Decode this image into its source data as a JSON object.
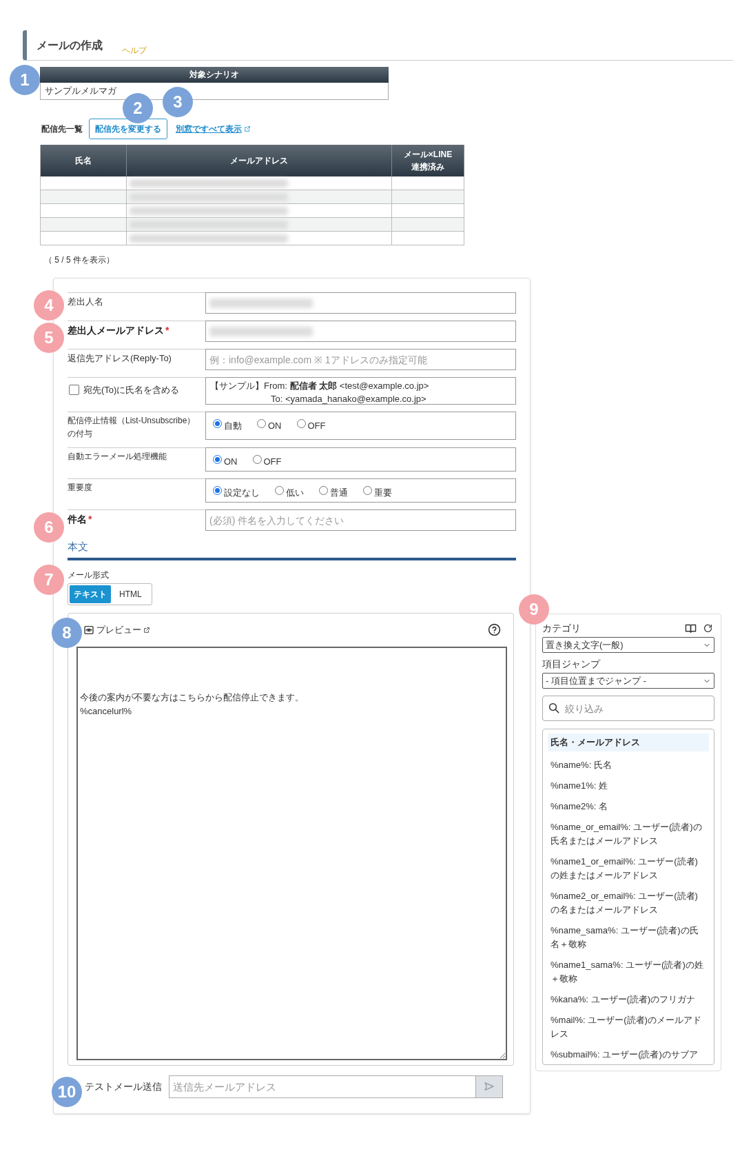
{
  "header": {
    "title": "メールの作成",
    "help_link": "ヘルプ"
  },
  "annotations": [
    {
      "label": "1",
      "color": "#7ba3d9"
    },
    {
      "label": "2",
      "color": "#7ba3d9"
    },
    {
      "label": "3",
      "color": "#7ba3d9"
    },
    {
      "label": "4",
      "color": "#f4a3a8"
    },
    {
      "label": "5",
      "color": "#f4a3a8"
    },
    {
      "label": "6",
      "color": "#f4a3a8"
    },
    {
      "label": "7",
      "color": "#f4a3a8"
    },
    {
      "label": "8",
      "color": "#7ba3d9"
    },
    {
      "label": "9",
      "color": "#f4a3a8"
    },
    {
      "label": "10",
      "color": "#7ba3d9"
    }
  ],
  "scenario": {
    "heading": "対象シナリオ",
    "value": "サンプルメルマガ"
  },
  "recipients": {
    "label": "配信先一覧",
    "change_button": "配信先を変更する",
    "open_all_link": "別窓ですべて表示",
    "columns": [
      "氏名",
      "メールアドレス",
      "メール×LINE\n連携済み"
    ],
    "rows": [
      {
        "email_blurred": true
      },
      {
        "email_blurred": true
      },
      {
        "email_blurred": true
      },
      {
        "email_blurred": true
      },
      {
        "email_blurred": true
      }
    ],
    "count_text": "（ 5 / 5 件を表示）"
  },
  "form": {
    "fields": [
      {
        "kind": "text",
        "label": "差出人名",
        "value_blurred": true
      },
      {
        "kind": "text",
        "label": "差出人メールアドレス",
        "required_mark": "*",
        "value_blurred": true
      },
      {
        "kind": "text",
        "label": "返信先アドレス(Reply-To)",
        "placeholder": "例：info@example.com ※ 1アドレスのみ指定可能"
      },
      {
        "kind": "checkbox_preview",
        "label": "宛先(To)に氏名を含める",
        "checked": false,
        "preview_lines": [
          "【サンプル】From: **配信者 太郎** <test@example.co.jp>",
          "To: <yamada_hanako@example.co.jp>"
        ]
      },
      {
        "kind": "radio",
        "label": "配信停止情報（List-Unsubscribe）の付与",
        "options": [
          {
            "label": "自動",
            "selected": true
          },
          {
            "label": "ON",
            "selected": false
          },
          {
            "label": "OFF",
            "selected": false
          }
        ]
      },
      {
        "kind": "radio",
        "label": "自動エラーメール処理機能",
        "options": [
          {
            "label": "ON",
            "selected": true
          },
          {
            "label": "OFF",
            "selected": false
          }
        ]
      },
      {
        "kind": "radio",
        "label": "重要度",
        "options": [
          {
            "label": "設定なし",
            "selected": true
          },
          {
            "label": "低い",
            "selected": false
          },
          {
            "label": "普通",
            "selected": false
          },
          {
            "label": "重要",
            "selected": false
          }
        ]
      },
      {
        "kind": "text",
        "label": "件名",
        "required_mark": "*",
        "placeholder": "(必須) 件名を入力してください"
      }
    ]
  },
  "body_section": {
    "heading": "本文",
    "format_label": "メール形式",
    "formats": [
      {
        "label": "テキスト",
        "selected": true
      },
      {
        "label": "HTML",
        "selected": false
      }
    ]
  },
  "editor": {
    "preview_link": "プレビュー",
    "content": "\n\n\n今後の案内が不要な方はこちらから配信停止できます。\n%cancelurl%"
  },
  "test_send": {
    "label": "テストメール送信",
    "placeholder": "送信先メールアドレス"
  },
  "sidebar": {
    "category_label": "カテゴリ",
    "category_value": "置き換え文字(一般)",
    "jump_label": "項目ジャンプ",
    "jump_value": "- 項目位置までジャンプ -",
    "filter_placeholder": "絞り込み",
    "group_heading": "氏名・メールアドレス",
    "items": [
      "%name%: 氏名",
      "%name1%: 姓",
      "%name2%: 名",
      "%name_or_email%: ユーザー(読者)の氏名またはメールアドレス",
      "%name1_or_email%: ユーザー(読者)の姓またはメールアドレス",
      "%name2_or_email%: ユーザー(読者)の名またはメールアドレス",
      "%name_sama%: ユーザー(読者)の氏名＋敬称",
      "%name1_sama%: ユーザー(読者)の姓＋敬称",
      "%kana%: ユーザー(読者)のフリガナ",
      "%mail%: ユーザー(読者)のメールアドレス",
      "%submail%: ユーザー(読者)のサブア"
    ]
  }
}
